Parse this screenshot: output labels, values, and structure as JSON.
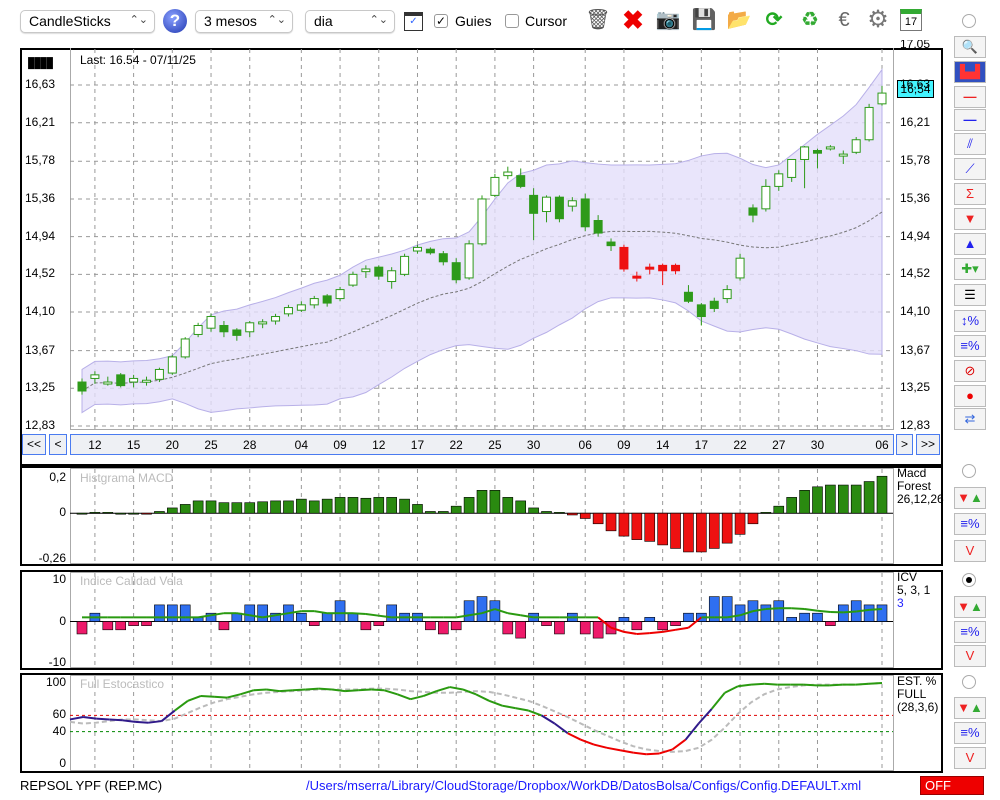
{
  "toolbar": {
    "chart_type": "CandleSticks",
    "period": "3 mesos",
    "interval": "dia",
    "guides_label": "Guies",
    "guides_checked": true,
    "cursor_label": "Cursor",
    "cursor_checked": false,
    "help": "?",
    "calendar_day": "17"
  },
  "main": {
    "last": "Last: 16.54 - 07/11/25",
    "current_price": "16,54",
    "top_label": "17,05",
    "price_labels": [
      "16,63",
      "16,21",
      "15,78",
      "15,36",
      "14,94",
      "14,52",
      "14,10",
      "13,67",
      "13,25",
      "12,83"
    ],
    "price_values": [
      16.63,
      16.21,
      15.78,
      15.36,
      14.94,
      14.52,
      14.1,
      13.67,
      13.25,
      12.83
    ],
    "nav": {
      "first": "<<",
      "prev": "<",
      "next": ">",
      "last": ">>"
    },
    "date_labels": [
      "12",
      "15",
      "20",
      "25",
      "28",
      "04",
      "09",
      "12",
      "17",
      "22",
      "25",
      "30",
      "06",
      "09",
      "14",
      "17",
      "22",
      "27",
      "30",
      "06"
    ],
    "date_index": [
      1,
      4,
      7,
      10,
      13,
      17,
      20,
      23,
      26,
      29,
      32,
      35,
      39,
      42,
      45,
      48,
      51,
      54,
      57,
      62
    ]
  },
  "colors": {
    "up_body": "#ffffff",
    "candle_green": "#2e9a1a",
    "candle_red": "#ee1111",
    "band": "#e3dffa",
    "current_price_bg": "#44f4ff",
    "macd_pos": "#2a8a10",
    "macd_neg": "#ee1111",
    "icv_pos": "#2f6ff0",
    "icv_neg": "#ee1a6a",
    "status_off": "#ee0000",
    "path_link": "#1a1aff"
  },
  "chart_data": [
    {
      "type": "candlestick",
      "title": "Last: 16.54 - 07/11/25",
      "ylim": [
        12.83,
        16.63
      ],
      "red_indices": [
        42,
        43,
        44,
        45,
        46
      ],
      "ohlc": [
        [
          13.32,
          13.36,
          13.18,
          13.22
        ],
        [
          13.36,
          13.44,
          13.3,
          13.4
        ],
        [
          13.3,
          13.38,
          13.28,
          13.32
        ],
        [
          13.4,
          13.42,
          13.26,
          13.28
        ],
        [
          13.32,
          13.4,
          13.26,
          13.36
        ],
        [
          13.33,
          13.38,
          13.28,
          13.34
        ],
        [
          13.35,
          13.48,
          13.32,
          13.46
        ],
        [
          13.42,
          13.62,
          13.4,
          13.6
        ],
        [
          13.6,
          13.82,
          13.58,
          13.8
        ],
        [
          13.85,
          13.98,
          13.82,
          13.95
        ],
        [
          13.92,
          14.08,
          13.88,
          14.05
        ],
        [
          13.95,
          14.0,
          13.82,
          13.88
        ],
        [
          13.9,
          13.92,
          13.78,
          13.84
        ],
        [
          13.88,
          14.0,
          13.82,
          13.98
        ],
        [
          13.97,
          14.02,
          13.92,
          13.99
        ],
        [
          14.0,
          14.08,
          13.96,
          14.05
        ],
        [
          14.08,
          14.18,
          14.05,
          14.15
        ],
        [
          14.12,
          14.22,
          14.1,
          14.18
        ],
        [
          14.18,
          14.28,
          14.14,
          14.25
        ],
        [
          14.28,
          14.3,
          14.16,
          14.2
        ],
        [
          14.25,
          14.38,
          14.22,
          14.35
        ],
        [
          14.4,
          14.55,
          14.38,
          14.52
        ],
        [
          14.55,
          14.62,
          14.48,
          14.58
        ],
        [
          14.6,
          14.62,
          14.46,
          14.5
        ],
        [
          14.44,
          14.6,
          14.36,
          14.56
        ],
        [
          14.52,
          14.75,
          14.5,
          14.72
        ],
        [
          14.78,
          14.85,
          14.75,
          14.82
        ],
        [
          14.8,
          14.82,
          14.74,
          14.76
        ],
        [
          14.75,
          14.78,
          14.62,
          14.66
        ],
        [
          14.65,
          14.7,
          14.42,
          14.46
        ],
        [
          14.48,
          14.9,
          14.46,
          14.86
        ],
        [
          14.86,
          15.4,
          14.84,
          15.36
        ],
        [
          15.4,
          15.64,
          15.38,
          15.6
        ],
        [
          15.62,
          15.72,
          15.58,
          15.66
        ],
        [
          15.62,
          15.7,
          15.48,
          15.5
        ],
        [
          15.4,
          15.48,
          14.9,
          15.2
        ],
        [
          15.22,
          15.4,
          15.1,
          15.38
        ],
        [
          15.38,
          15.4,
          15.1,
          15.14
        ],
        [
          15.28,
          15.38,
          15.22,
          15.34
        ],
        [
          15.36,
          15.42,
          15.0,
          15.05
        ],
        [
          15.12,
          15.18,
          14.94,
          14.98
        ],
        [
          14.88,
          14.92,
          14.78,
          14.84
        ],
        [
          14.82,
          14.85,
          14.55,
          14.58
        ],
        [
          14.5,
          14.55,
          14.44,
          14.48
        ],
        [
          14.6,
          14.64,
          14.52,
          14.58
        ],
        [
          14.62,
          14.64,
          14.4,
          14.56
        ],
        [
          14.62,
          14.64,
          14.52,
          14.56
        ],
        [
          14.32,
          14.4,
          14.2,
          14.22
        ],
        [
          14.18,
          14.2,
          13.95,
          14.05
        ],
        [
          14.22,
          14.26,
          14.1,
          14.14
        ],
        [
          14.25,
          14.4,
          14.2,
          14.35
        ],
        [
          14.48,
          14.75,
          14.45,
          14.7
        ],
        [
          15.26,
          15.3,
          15.1,
          15.18
        ],
        [
          15.25,
          15.58,
          15.22,
          15.5
        ],
        [
          15.5,
          15.68,
          15.45,
          15.64
        ],
        [
          15.6,
          15.8,
          15.55,
          15.8
        ],
        [
          15.8,
          15.95,
          15.48,
          15.94
        ],
        [
          15.9,
          15.92,
          15.7,
          15.87
        ],
        [
          15.92,
          15.96,
          15.9,
          15.94
        ],
        [
          15.84,
          15.9,
          15.75,
          15.86
        ],
        [
          15.88,
          16.05,
          15.86,
          16.02
        ],
        [
          16.02,
          16.42,
          16.0,
          16.38
        ],
        [
          16.42,
          16.62,
          16.4,
          16.54
        ]
      ]
    },
    {
      "type": "bar",
      "title": "Histgrama MACD",
      "legend": [
        "Macd",
        "Forest",
        "26,12,26"
      ],
      "ylim": [
        -0.26,
        0.2
      ],
      "tick_labels": [
        "0,2",
        "0",
        "-0,26"
      ],
      "tick_values": [
        0.2,
        0,
        -0.26
      ],
      "values": [
        0,
        0.005,
        0.005,
        0,
        0,
        -0.005,
        0.01,
        0.03,
        0.05,
        0.07,
        0.07,
        0.06,
        0.06,
        0.06,
        0.065,
        0.07,
        0.07,
        0.08,
        0.07,
        0.08,
        0.09,
        0.09,
        0.085,
        0.09,
        0.09,
        0.08,
        0.05,
        0.01,
        0.01,
        0.04,
        0.09,
        0.13,
        0.13,
        0.09,
        0.07,
        0.03,
        0.01,
        0.005,
        -0.01,
        -0.03,
        -0.06,
        -0.1,
        -0.13,
        -0.15,
        -0.16,
        -0.18,
        -0.2,
        -0.22,
        -0.22,
        -0.2,
        -0.17,
        -0.12,
        -0.06,
        0.005,
        0.04,
        0.09,
        0.13,
        0.15,
        0.16,
        0.16,
        0.16,
        0.18,
        0.21
      ]
    },
    {
      "type": "bar",
      "title": "Indice Calidad Vela",
      "legend": [
        "ICV",
        "5, 3, 1",
        "3"
      ],
      "ylim": [
        -10,
        10
      ],
      "tick_labels": [
        "10",
        "0",
        "-10"
      ],
      "tick_values": [
        10,
        0,
        -10
      ],
      "values": [
        -3,
        2,
        -2,
        -2,
        -1,
        -1,
        4,
        4,
        4,
        1,
        2,
        -2,
        2,
        4,
        4,
        2,
        4,
        2,
        -1,
        2,
        5,
        2,
        -2,
        -1,
        4,
        2,
        2,
        -2,
        -3,
        -2,
        5,
        6,
        5,
        -3,
        -4,
        2,
        -1,
        -3,
        2,
        -3,
        -4,
        -3,
        1,
        -2,
        1,
        -2,
        -1,
        2,
        2,
        6,
        6,
        4,
        5,
        4,
        5,
        1,
        2,
        2,
        -1,
        4,
        5,
        4,
        4
      ],
      "signal": [
        1,
        1,
        1,
        1,
        1,
        1,
        1,
        1,
        1,
        1,
        1.5,
        2,
        2,
        1.5,
        1,
        1.5,
        2,
        2.5,
        2.5,
        2,
        2,
        2,
        1.8,
        1.4,
        1,
        1,
        1,
        1,
        1,
        1,
        1.5,
        2,
        3,
        2,
        1.5,
        1,
        1,
        1,
        1,
        1,
        1,
        -1.5,
        -2.5,
        -3,
        -2.8,
        -2.5,
        -2,
        -1.5,
        1,
        1,
        1,
        1.5,
        2.5,
        3,
        3.2,
        3.2,
        3,
        2.6,
        2.3,
        2.2,
        2.4,
        2.8,
        3
      ]
    },
    {
      "type": "line",
      "title": "Full Estocastico",
      "legend": [
        "EST. %",
        "FULL",
        "(28,3,6)"
      ],
      "ylim": [
        0,
        100
      ],
      "tick_labels": [
        "100",
        "60",
        "40",
        "0"
      ],
      "tick_values": [
        100,
        60,
        40,
        0
      ],
      "levels": [
        60,
        40
      ],
      "k": [
        55,
        58,
        56,
        55,
        54,
        52,
        51,
        53,
        66,
        78,
        84,
        83,
        82,
        86,
        91,
        92,
        90,
        91,
        92,
        93,
        92,
        90,
        91,
        92,
        91,
        86,
        80,
        84,
        90,
        95,
        92,
        86,
        78,
        72,
        69,
        66,
        60,
        50,
        38,
        30,
        24,
        20,
        17,
        14,
        12,
        13,
        18,
        30,
        50,
        68,
        88,
        96,
        98,
        99,
        98,
        98,
        98,
        97,
        97,
        98,
        98,
        99,
        100
      ],
      "d": [
        52,
        50,
        51,
        53,
        55,
        55,
        54,
        53,
        56,
        63,
        70,
        76,
        80,
        83,
        86,
        88,
        89,
        90,
        91,
        92,
        92,
        92,
        92,
        93,
        93,
        92,
        90,
        89,
        88,
        88,
        89,
        90,
        89,
        86,
        82,
        78,
        72,
        65,
        58,
        50,
        42,
        35,
        28,
        22,
        18,
        16,
        15,
        16,
        20,
        30,
        45,
        62,
        76,
        86,
        92,
        95,
        97,
        98,
        98,
        98,
        98,
        99,
        100
      ]
    }
  ],
  "status": {
    "ticker": "REPSOL YPF (REP.MC)",
    "config_path": "/Users/mserra/Library/CloudStorage/Dropbox/WorkDB/DatosBolsa/Configs/Config.DEFAULT.xml",
    "state": "OFF"
  }
}
